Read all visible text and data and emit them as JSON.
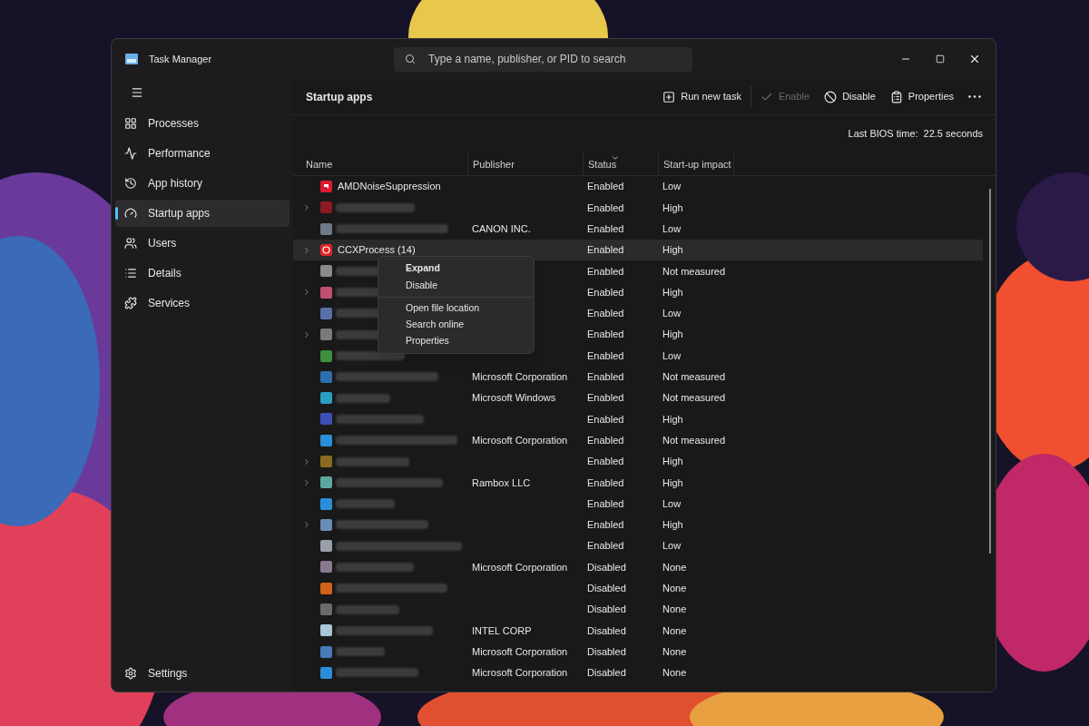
{
  "window": {
    "title": "Task Manager"
  },
  "search": {
    "placeholder": "Type a name, publisher, or PID to search"
  },
  "sidebar": {
    "items": [
      {
        "label": "Processes",
        "kind": "processes",
        "selected": false
      },
      {
        "label": "Performance",
        "kind": "performance",
        "selected": false
      },
      {
        "label": "App history",
        "kind": "history",
        "selected": false
      },
      {
        "label": "Startup apps",
        "kind": "startup",
        "selected": true
      },
      {
        "label": "Users",
        "kind": "users",
        "selected": false
      },
      {
        "label": "Details",
        "kind": "details",
        "selected": false
      },
      {
        "label": "Services",
        "kind": "services",
        "selected": false
      }
    ],
    "settings": "Settings"
  },
  "page_title": "Startup apps",
  "toolbar": [
    {
      "label": "Run new task",
      "kind": "run",
      "disabled": false
    },
    {
      "label": "Enable",
      "kind": "enable",
      "disabled": true
    },
    {
      "label": "Disable",
      "kind": "disable",
      "disabled": false
    },
    {
      "label": "Properties",
      "kind": "properties",
      "disabled": false
    }
  ],
  "bios": {
    "label": "Last BIOS time:",
    "value": "22.5 seconds"
  },
  "table": {
    "columns": [
      {
        "label": "Name",
        "sorted": false
      },
      {
        "label": "Publisher",
        "sorted": false
      },
      {
        "label": "Status",
        "sorted": true
      },
      {
        "label": "Start-up impact",
        "sorted": false
      }
    ],
    "rows": [
      {
        "name": "AMDNoiseSuppression",
        "kind": "amd",
        "color": "#e0182f",
        "expandable": false,
        "selected": false,
        "status": "Enabled",
        "impact": "Low"
      },
      {
        "kind": "app",
        "color": "#8a1a24",
        "expandable": true,
        "selected": false,
        "status": "Enabled",
        "impact": "High"
      },
      {
        "kind": "app",
        "color": "#6e7a86",
        "expandable": false,
        "selected": false,
        "publisher": "CANON INC.",
        "status": "Enabled",
        "impact": "Low"
      },
      {
        "name": "CCXProcess (14)",
        "kind": "ccx",
        "color": "#e0242a",
        "expandable": true,
        "selected": true,
        "status": "Enabled",
        "impact": "High"
      },
      {
        "kind": "app",
        "color": "#8a8a8a",
        "expandable": false,
        "selected": false,
        "status": "Enabled",
        "impact": "Not measured"
      },
      {
        "kind": "app",
        "color": "#c05070",
        "expandable": true,
        "selected": false,
        "status": "Enabled",
        "impact": "High"
      },
      {
        "kind": "app",
        "color": "#5a6fa8",
        "expandable": false,
        "selected": false,
        "status": "Enabled",
        "impact": "Low"
      },
      {
        "kind": "app",
        "color": "#7a7a7a",
        "expandable": true,
        "selected": false,
        "status": "Enabled",
        "impact": "High"
      },
      {
        "kind": "app",
        "color": "#3f8f3f",
        "expandable": false,
        "selected": false,
        "status": "Enabled",
        "impact": "Low"
      },
      {
        "kind": "app",
        "color": "#2e6fb0",
        "expandable": false,
        "selected": false,
        "publisher": "Microsoft Corporation",
        "status": "Enabled",
        "impact": "Not measured"
      },
      {
        "kind": "app",
        "color": "#2a9fc0",
        "expandable": false,
        "selected": false,
        "publisher": "Microsoft Windows",
        "status": "Enabled",
        "impact": "Not measured"
      },
      {
        "kind": "app",
        "color": "#3a4fb8",
        "expandable": false,
        "selected": false,
        "status": "Enabled",
        "impact": "High"
      },
      {
        "kind": "app",
        "color": "#2a8fd8",
        "expandable": false,
        "selected": false,
        "publisher": "Microsoft Corporation",
        "status": "Enabled",
        "impact": "Not measured"
      },
      {
        "kind": "app",
        "color": "#8a6a20",
        "expandable": true,
        "selected": false,
        "status": "Enabled",
        "impact": "High"
      },
      {
        "kind": "app",
        "color": "#5aa8a0",
        "expandable": true,
        "selected": false,
        "publisher": "Rambox LLC",
        "status": "Enabled",
        "impact": "High"
      },
      {
        "kind": "app",
        "color": "#2a8fd8",
        "expandable": false,
        "selected": false,
        "status": "Enabled",
        "impact": "Low"
      },
      {
        "kind": "app",
        "color": "#6a8ab8",
        "expandable": true,
        "selected": false,
        "status": "Enabled",
        "impact": "High"
      },
      {
        "kind": "app",
        "color": "#9aa0a8",
        "expandable": false,
        "selected": false,
        "status": "Enabled",
        "impact": "Low"
      },
      {
        "kind": "app",
        "color": "#8a7a90",
        "expandable": false,
        "selected": false,
        "publisher": "Microsoft Corporation",
        "status": "Disabled",
        "impact": "None"
      },
      {
        "kind": "app",
        "color": "#d0601a",
        "expandable": false,
        "selected": false,
        "status": "Disabled",
        "impact": "None"
      },
      {
        "kind": "app",
        "color": "#6a6a6a",
        "expandable": false,
        "selected": false,
        "status": "Disabled",
        "impact": "None"
      },
      {
        "kind": "app",
        "color": "#a8c8d8",
        "expandable": false,
        "selected": false,
        "publisher": "INTEL CORP",
        "status": "Disabled",
        "impact": "None"
      },
      {
        "kind": "app",
        "color": "#4a7ab8",
        "expandable": false,
        "selected": false,
        "publisher": "Microsoft Corporation",
        "status": "Disabled",
        "impact": "None"
      },
      {
        "kind": "app",
        "color": "#2a8fd8",
        "expandable": false,
        "selected": false,
        "publisher": "Microsoft Corporation",
        "status": "Disabled",
        "impact": "None"
      }
    ]
  },
  "context_menu": [
    {
      "label": "Expand",
      "default": true,
      "separator_before": false
    },
    {
      "label": "Disable",
      "default": false,
      "separator_before": false
    },
    {
      "label": "Open file location",
      "default": false,
      "separator_before": true
    },
    {
      "label": "Search online",
      "default": false,
      "separator_before": false
    },
    {
      "label": "Properties",
      "default": false,
      "separator_before": false
    }
  ]
}
